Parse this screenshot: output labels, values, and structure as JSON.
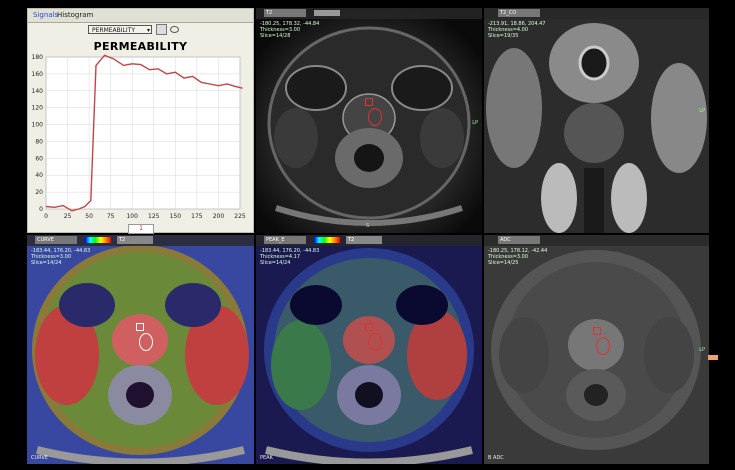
{
  "chart_panel": {
    "tabs": [
      "Signals",
      "Histogram"
    ],
    "dropdown": "PERMEABILITY",
    "legend": "1"
  },
  "chart_data": {
    "type": "line",
    "title": "PERMEABILITY",
    "xlabel": "",
    "ylabel": "",
    "xlim": [
      0,
      225
    ],
    "ylim": [
      0,
      180
    ],
    "xticks": [
      0,
      25,
      50,
      75,
      100,
      125,
      150,
      175,
      200,
      225
    ],
    "yticks": [
      0,
      20,
      40,
      60,
      80,
      100,
      120,
      140,
      160,
      180
    ],
    "grid": true,
    "series": [
      {
        "name": "1",
        "color": "#c44444",
        "x": [
          0,
          10,
          20,
          25,
          30,
          38,
          45,
          52,
          58,
          68,
          78,
          90,
          100,
          110,
          120,
          130,
          140,
          150,
          160,
          170,
          180,
          190,
          200,
          210,
          220,
          228
        ],
        "y": [
          3,
          2,
          4,
          1,
          -2,
          0,
          3,
          10,
          170,
          182,
          178,
          170,
          172,
          171,
          165,
          166,
          160,
          162,
          155,
          157,
          150,
          148,
          146,
          148,
          145,
          143
        ]
      }
    ]
  },
  "panels": {
    "t2_axial": {
      "dropdown": "T2",
      "info": "-180.25, 178.32, -44.84\nThickness=3.00\nSlice=14/28",
      "label_right": "LP",
      "label_bottom": "S"
    },
    "t2_coronal": {
      "dropdown": "T2_CO",
      "info": "-213.91, 18.86, 204.47\nThickness=4.00\nSlice=19/35",
      "label_right": "LP"
    },
    "curve": {
      "dropdown1": "CURVE",
      "dropdown2": "T2",
      "info": "-183.44, 176.20, -44.83\nThickness=3.00\nSlice=14/24",
      "label_bottom": "CURVE"
    },
    "peak": {
      "dropdown1": "PEAK_E",
      "dropdown2": "T2",
      "info": "-183.44, 176.20, -44.83\nThickness=4.17\nSlice=14/24",
      "label_bottom": "PEAK"
    },
    "adc": {
      "dropdown": "ADC",
      "info": "-180.25, 178.12, -42.44\nThickness=3.00\nSlice=14/25",
      "label_right": "LP",
      "label_bottom": "B ADC"
    }
  }
}
